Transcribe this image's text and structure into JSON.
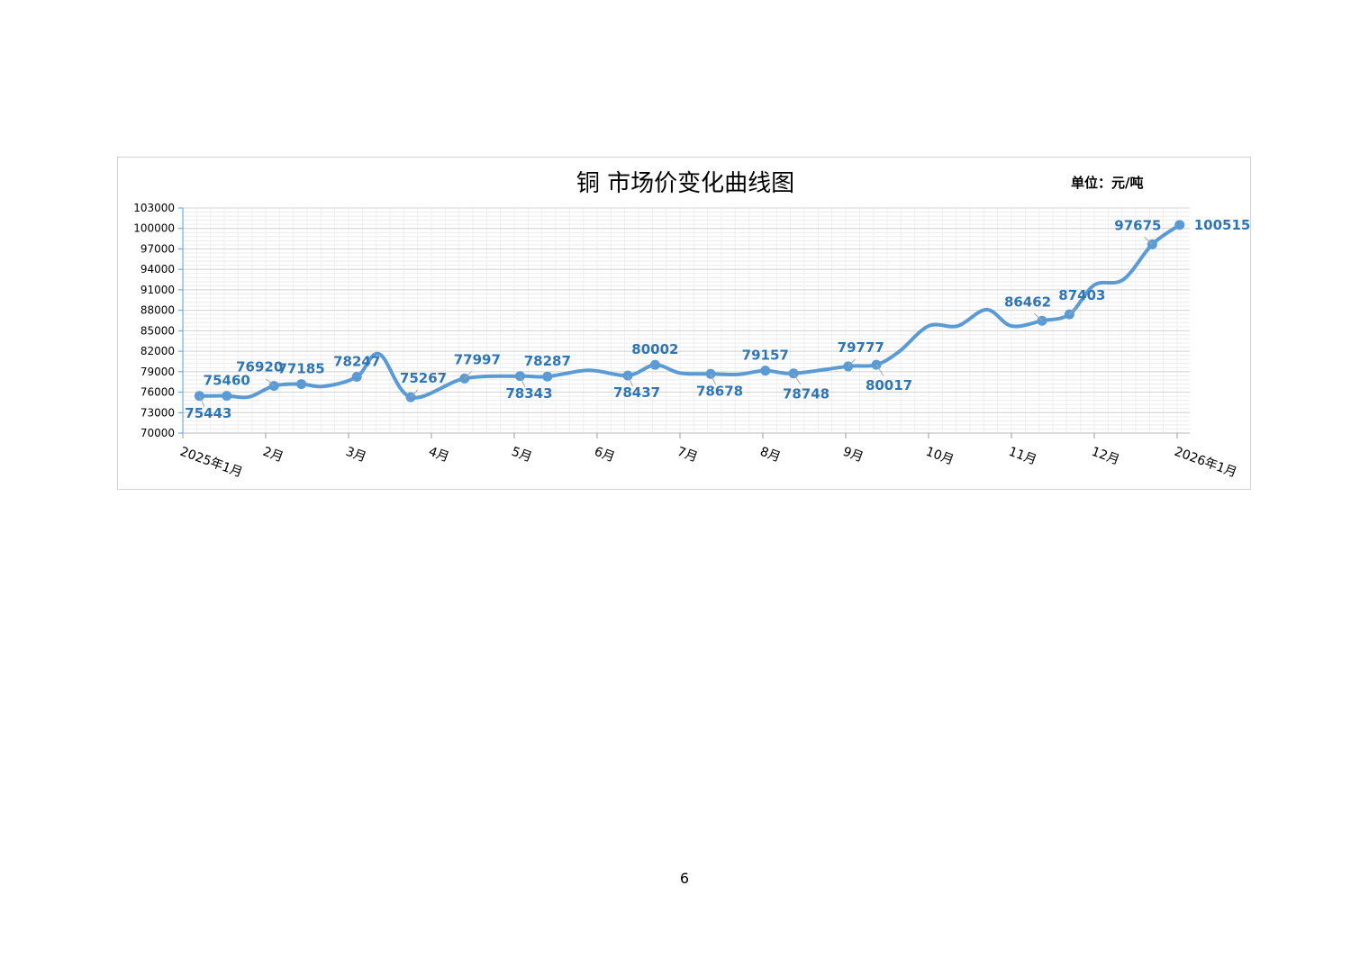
{
  "page_number": "6",
  "chart_data": {
    "type": "line",
    "title": "铜  市场价变化曲线图",
    "unit_label": "单位：元/吨",
    "ylim": [
      70000,
      103000
    ],
    "y_ticks": [
      70000,
      73000,
      76000,
      79000,
      82000,
      85000,
      88000,
      91000,
      94000,
      97000,
      100000,
      103000
    ],
    "grid": true,
    "line_color": "#5b9bd5",
    "label_color": "#2e75b6",
    "x_tick_labels": [
      "2025年1月",
      "2月",
      "3月",
      "4月",
      "5月",
      "6月",
      "7月",
      "8月",
      "9月",
      "10月",
      "11月",
      "12月",
      "2026年1月"
    ],
    "curve_points": [
      {
        "x": 0.2,
        "y": 75443
      },
      {
        "x": 0.53,
        "y": 75460
      },
      {
        "x": 0.8,
        "y": 75300
      },
      {
        "x": 1.1,
        "y": 76920
      },
      {
        "x": 1.43,
        "y": 77185
      },
      {
        "x": 1.7,
        "y": 76850
      },
      {
        "x": 2.1,
        "y": 78247
      },
      {
        "x": 2.37,
        "y": 81600
      },
      {
        "x": 2.75,
        "y": 75267
      },
      {
        "x": 3.4,
        "y": 77997
      },
      {
        "x": 4.07,
        "y": 78343
      },
      {
        "x": 4.4,
        "y": 78287
      },
      {
        "x": 4.9,
        "y": 79200
      },
      {
        "x": 5.37,
        "y": 78437
      },
      {
        "x": 5.7,
        "y": 80002
      },
      {
        "x": 6.0,
        "y": 78800
      },
      {
        "x": 6.37,
        "y": 78678
      },
      {
        "x": 6.7,
        "y": 78600
      },
      {
        "x": 7.03,
        "y": 79157
      },
      {
        "x": 7.37,
        "y": 78748
      },
      {
        "x": 8.03,
        "y": 79777
      },
      {
        "x": 8.37,
        "y": 80017
      },
      {
        "x": 8.65,
        "y": 82000
      },
      {
        "x": 9.0,
        "y": 85700
      },
      {
        "x": 9.35,
        "y": 85700
      },
      {
        "x": 9.7,
        "y": 88100
      },
      {
        "x": 10.0,
        "y": 85700
      },
      {
        "x": 10.37,
        "y": 86462
      },
      {
        "x": 10.7,
        "y": 87403
      },
      {
        "x": 11.0,
        "y": 91700
      },
      {
        "x": 11.35,
        "y": 92500
      },
      {
        "x": 11.7,
        "y": 97675
      },
      {
        "x": 12.03,
        "y": 100515
      }
    ],
    "labeled_points": [
      {
        "x": 0.2,
        "y": 75443,
        "label": "75443",
        "pos": "below"
      },
      {
        "x": 0.53,
        "y": 75460,
        "label": "75460",
        "pos": "above"
      },
      {
        "x": 1.1,
        "y": 76920,
        "label": "76920",
        "pos": "above-left"
      },
      {
        "x": 1.43,
        "y": 77185,
        "label": "77185",
        "pos": "above"
      },
      {
        "x": 2.1,
        "y": 78247,
        "label": "78247",
        "pos": "above"
      },
      {
        "x": 2.75,
        "y": 75267,
        "label": "75267",
        "pos": "above-right"
      },
      {
        "x": 3.4,
        "y": 77997,
        "label": "77997",
        "pos": "above-right"
      },
      {
        "x": 4.07,
        "y": 78343,
        "label": "78343",
        "pos": "below"
      },
      {
        "x": 4.4,
        "y": 78287,
        "label": "78287",
        "pos": "above"
      },
      {
        "x": 5.37,
        "y": 78437,
        "label": "78437",
        "pos": "below"
      },
      {
        "x": 5.7,
        "y": 80002,
        "label": "80002",
        "pos": "above"
      },
      {
        "x": 6.37,
        "y": 78678,
        "label": "78678",
        "pos": "below"
      },
      {
        "x": 7.03,
        "y": 79157,
        "label": "79157",
        "pos": "above"
      },
      {
        "x": 7.37,
        "y": 78748,
        "label": "78748",
        "pos": "below-right"
      },
      {
        "x": 8.03,
        "y": 79777,
        "label": "79777",
        "pos": "above-right"
      },
      {
        "x": 8.37,
        "y": 80017,
        "label": "80017",
        "pos": "below-right"
      },
      {
        "x": 10.37,
        "y": 86462,
        "label": "86462",
        "pos": "above-left"
      },
      {
        "x": 10.7,
        "y": 87403,
        "label": "87403",
        "pos": "above-right"
      },
      {
        "x": 11.7,
        "y": 97675,
        "label": "97675",
        "pos": "above-left"
      },
      {
        "x": 12.03,
        "y": 100515,
        "label": "100515",
        "pos": "right"
      }
    ]
  }
}
